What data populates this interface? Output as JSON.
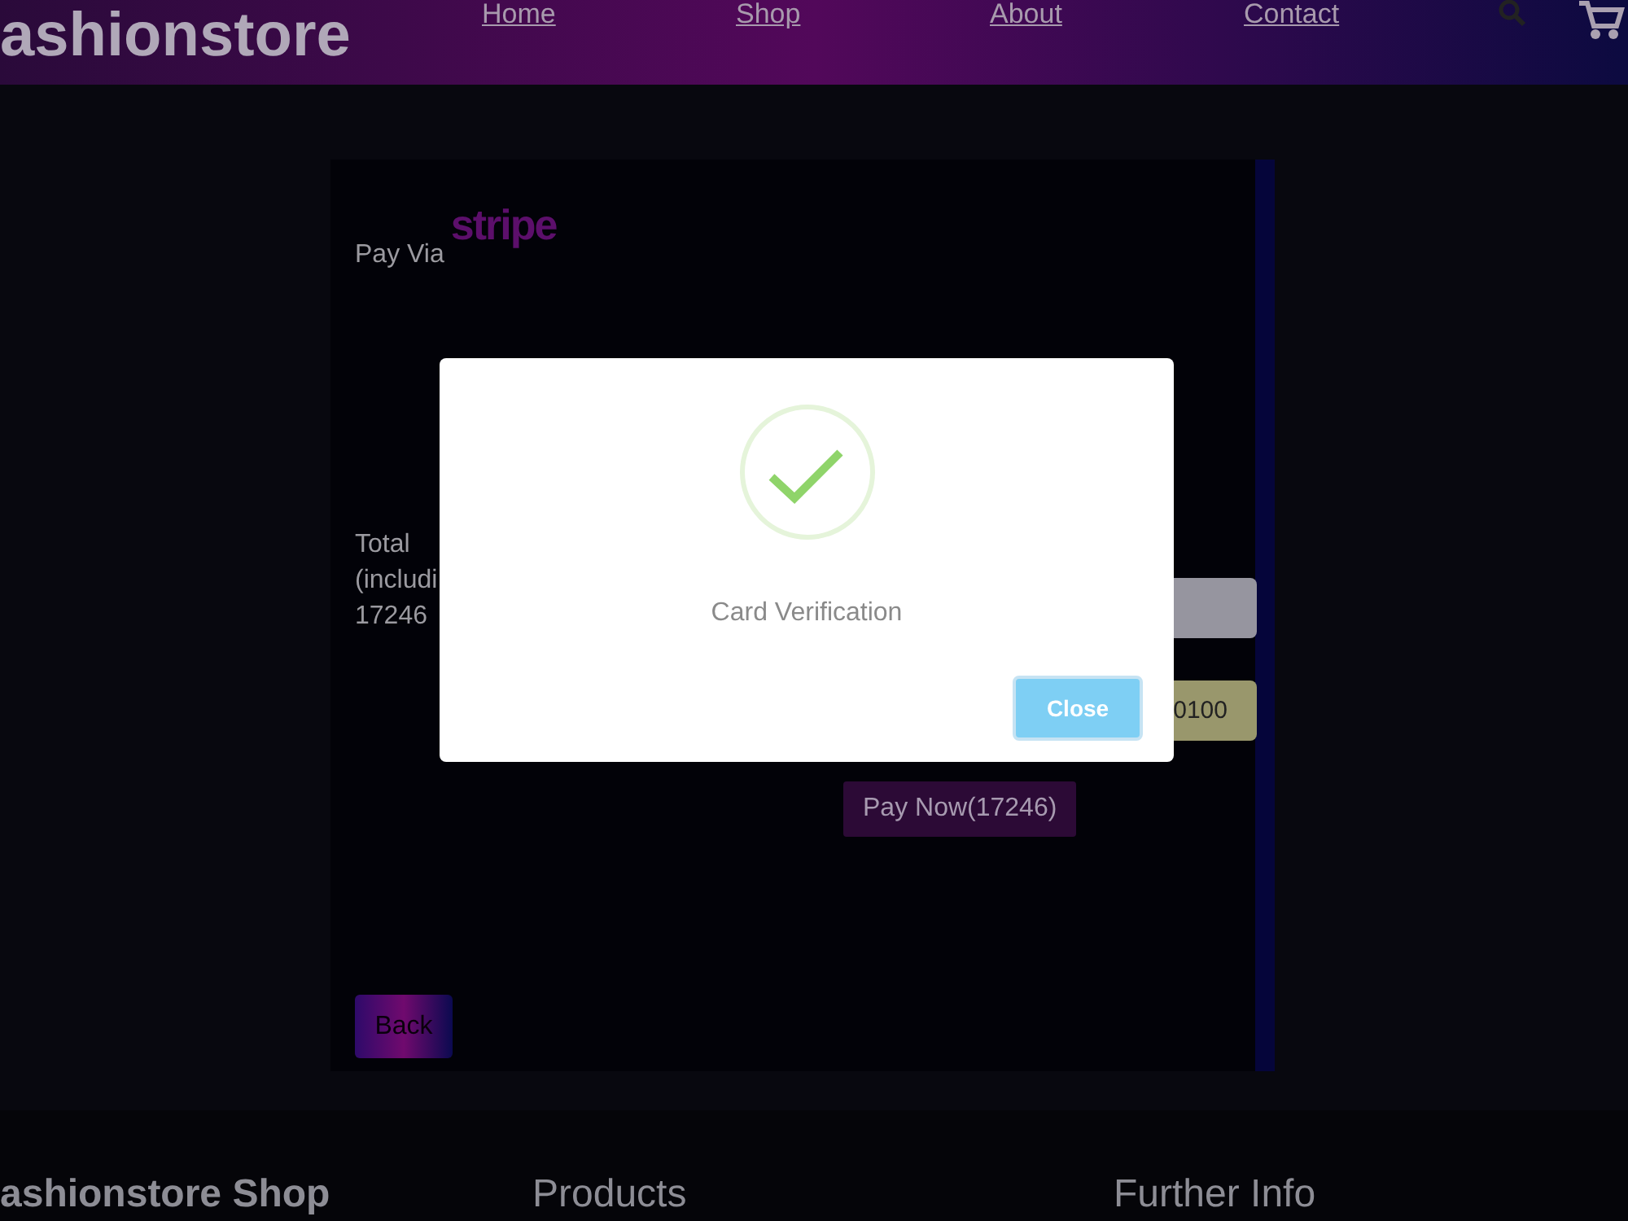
{
  "header": {
    "logo": "ashionstore",
    "nav": [
      {
        "label": "Home"
      },
      {
        "label": "Shop"
      },
      {
        "label": "About"
      },
      {
        "label": "Contact"
      }
    ]
  },
  "payment": {
    "pay_via": "Pay Via",
    "brand": "stripe",
    "total_label": "Total",
    "total_note": "(includi",
    "total_value": "17246",
    "amount_field": {
      "value": "0100"
    },
    "pay_button": "Pay Now(17246)",
    "back_button": "Back"
  },
  "footer": {
    "columns": [
      "ashionstore Shop",
      "Products",
      "Further Info"
    ]
  },
  "modal": {
    "message": "Card Verification",
    "close_button": "Close"
  }
}
